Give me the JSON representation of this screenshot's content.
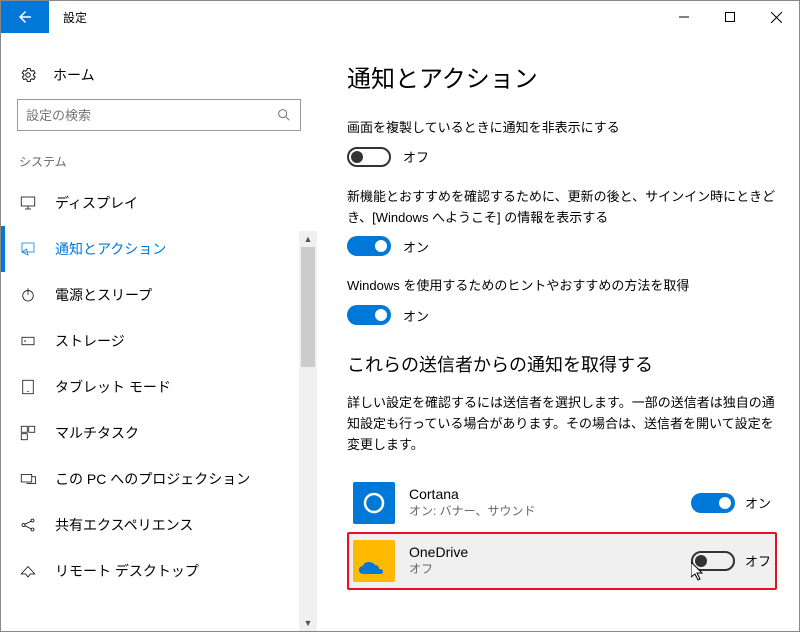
{
  "titlebar": {
    "title": "設定"
  },
  "sidebar": {
    "home_label": "ホーム",
    "search_placeholder": "設定の検索",
    "category_label": "システム",
    "items": [
      {
        "label": "ディスプレイ"
      },
      {
        "label": "通知とアクション"
      },
      {
        "label": "電源とスリープ"
      },
      {
        "label": "ストレージ"
      },
      {
        "label": "タブレット モード"
      },
      {
        "label": "マルチタスク"
      },
      {
        "label": "この PC へのプロジェクション"
      },
      {
        "label": "共有エクスペリエンス"
      },
      {
        "label": "リモート デスクトップ"
      }
    ]
  },
  "main": {
    "page_title": "通知とアクション",
    "settings": [
      {
        "text": "画面を複製しているときに通知を非表示にする",
        "state": "off",
        "state_label": "オフ"
      },
      {
        "text": "新機能とおすすめを確認するために、更新の後と、サインイン時にときどき、[Windows へようこそ] の情報を表示する",
        "state": "on",
        "state_label": "オン"
      },
      {
        "text": "Windows を使用するためのヒントやおすすめの方法を取得",
        "state": "on",
        "state_label": "オン"
      }
    ],
    "senders_heading": "これらの送信者からの通知を取得する",
    "senders_desc": "詳しい設定を確認するには送信者を選択します。一部の送信者は独自の通知設定も行っている場合があります。その場合は、送信者を開いて設定を変更します。",
    "senders": [
      {
        "name": "Cortana",
        "sub": "オン: バナー、サウンド",
        "state": "on",
        "state_label": "オン"
      },
      {
        "name": "OneDrive",
        "sub": "オフ",
        "state": "off",
        "state_label": "オフ"
      }
    ]
  }
}
